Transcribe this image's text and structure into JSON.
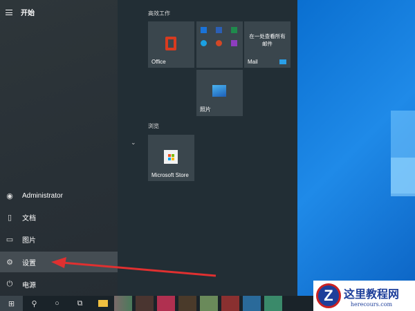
{
  "start": {
    "menu_label": "开始"
  },
  "left_items": [
    {
      "label": "Administrator",
      "icon": "user-icon"
    },
    {
      "label": "文档",
      "icon": "document-icon"
    },
    {
      "label": "图片",
      "icon": "pictures-icon"
    },
    {
      "label": "设置",
      "icon": "gear-icon",
      "selected": true
    },
    {
      "label": "电源",
      "icon": "power-icon"
    }
  ],
  "groups": {
    "productivity": "高效工作",
    "browse": "浏览"
  },
  "tiles": {
    "office": "Office",
    "mail": "Mail",
    "mail_text": "在一处查看所有邮件",
    "photos": "照片",
    "store": "Microsoft Store"
  },
  "watermark": {
    "title": "这里教程网",
    "url": "herecours.com"
  },
  "colors": {
    "arrow": "#e03030",
    "accent": "#0a6fd0"
  }
}
